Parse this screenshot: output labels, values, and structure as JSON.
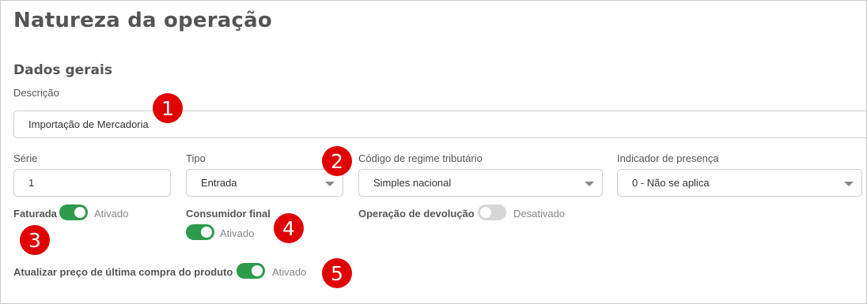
{
  "title": "Natureza da operação",
  "section": "Dados gerais",
  "descricao": {
    "label": "Descrição",
    "value": "Importação de Mercadoria"
  },
  "serie": {
    "label": "Série",
    "value": "1"
  },
  "tipo": {
    "label": "Tipo",
    "value": "Entrada"
  },
  "regime": {
    "label": "Código de regime tributário",
    "value": "Simples nacional"
  },
  "presenca": {
    "label": "Indicador de presença",
    "value": "0 - Não se aplica"
  },
  "faturada": {
    "label": "Faturada",
    "state": "Ativado",
    "on": true
  },
  "consumidor": {
    "label": "Consumidor final",
    "state": "Ativado",
    "on": true
  },
  "devolucao": {
    "label": "Operação de devolução",
    "state": "Desativado",
    "on": false
  },
  "atualizar": {
    "label": "Atualizar preço de última compra do produto",
    "state": "Ativado",
    "on": true
  },
  "badges": [
    "1",
    "2",
    "3",
    "4",
    "5"
  ],
  "colors": {
    "toggle_on": "#2e9a4b",
    "toggle_off": "#d6d6d6",
    "badge": "#e00000"
  }
}
